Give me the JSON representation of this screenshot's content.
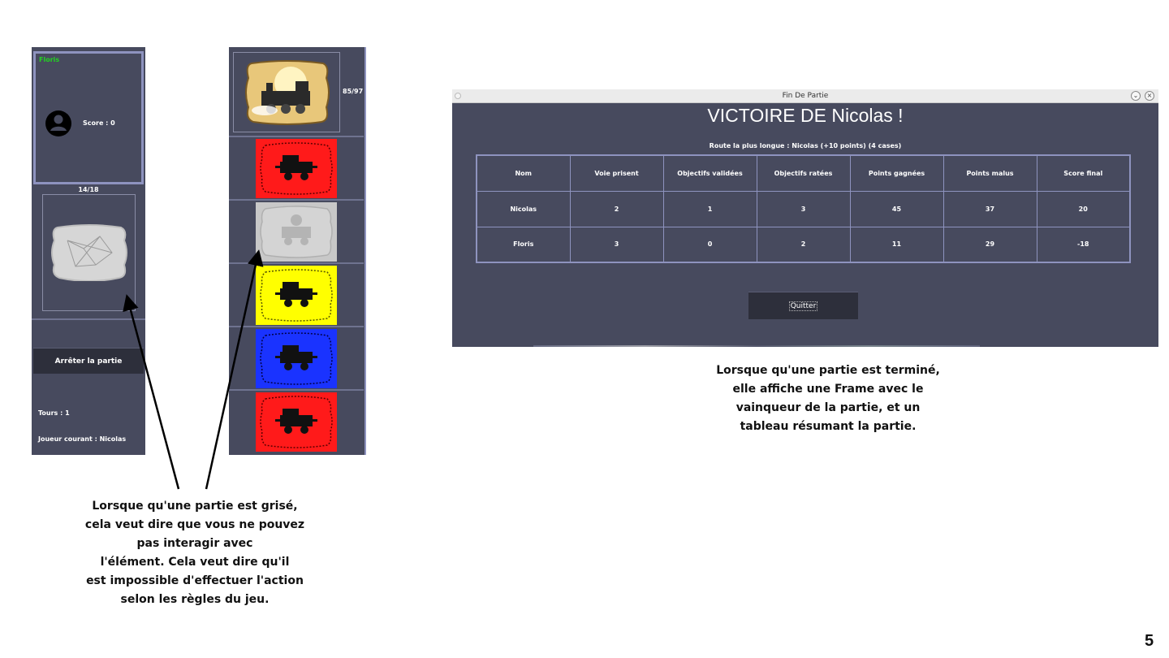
{
  "player_panel": {
    "player_name": "Floris",
    "score": "Score : 0",
    "objective_count": "14/18",
    "stop_button": "Arrêter la partie",
    "turns": "Tours : 1",
    "current_player": "Joueur courant : Nicolas"
  },
  "deck_panel": {
    "deck_count": "85/97",
    "cards": [
      {
        "color": "red",
        "state": "enabled"
      },
      {
        "color": "grey",
        "state": "disabled"
      },
      {
        "color": "yellow",
        "state": "enabled"
      },
      {
        "color": "blue",
        "state": "enabled"
      },
      {
        "color": "red",
        "state": "enabled"
      }
    ]
  },
  "end_frame": {
    "window_title": "Fin De Partie",
    "victory_title": "VICTOIRE DE Nicolas !",
    "longest_route": "Route la plus longue : Nicolas (+10 points) (4 cases)",
    "table": {
      "headers": [
        "Nom",
        "Voie prisent",
        "Objectifs validées",
        "Objectifs ratées",
        "Points gagnées",
        "Points malus",
        "Score final"
      ],
      "rows": [
        [
          "Nicolas",
          "2",
          "1",
          "3",
          "45",
          "37",
          "20"
        ],
        [
          "Floris",
          "3",
          "0",
          "2",
          "11",
          "29",
          "-18"
        ]
      ]
    },
    "quit_button": "Quitter"
  },
  "captions": {
    "left_lines": [
      "Lorsque qu'une partie est grisé,",
      "cela veut dire que vous ne pouvez",
      "pas interagir avec",
      "l'élément. Cela veut dire qu'il",
      "est impossible d'effectuer l'action",
      "selon les règles du jeu."
    ],
    "right_lines": [
      "Lorsque qu'une partie est terminé,",
      "elle affiche une Frame avec le",
      "vainqueur de la partie, et un",
      "tableau résumant la partie."
    ]
  },
  "page_number": "5",
  "colors": {
    "panel_bg": "#474a5e",
    "panel_border": "#8e93bf",
    "player_name": "#22d122",
    "card_red": "#ff1a1a",
    "card_yellow": "#ffff00",
    "card_blue": "#1a33ff",
    "card_grey": "#c8c8c8"
  }
}
